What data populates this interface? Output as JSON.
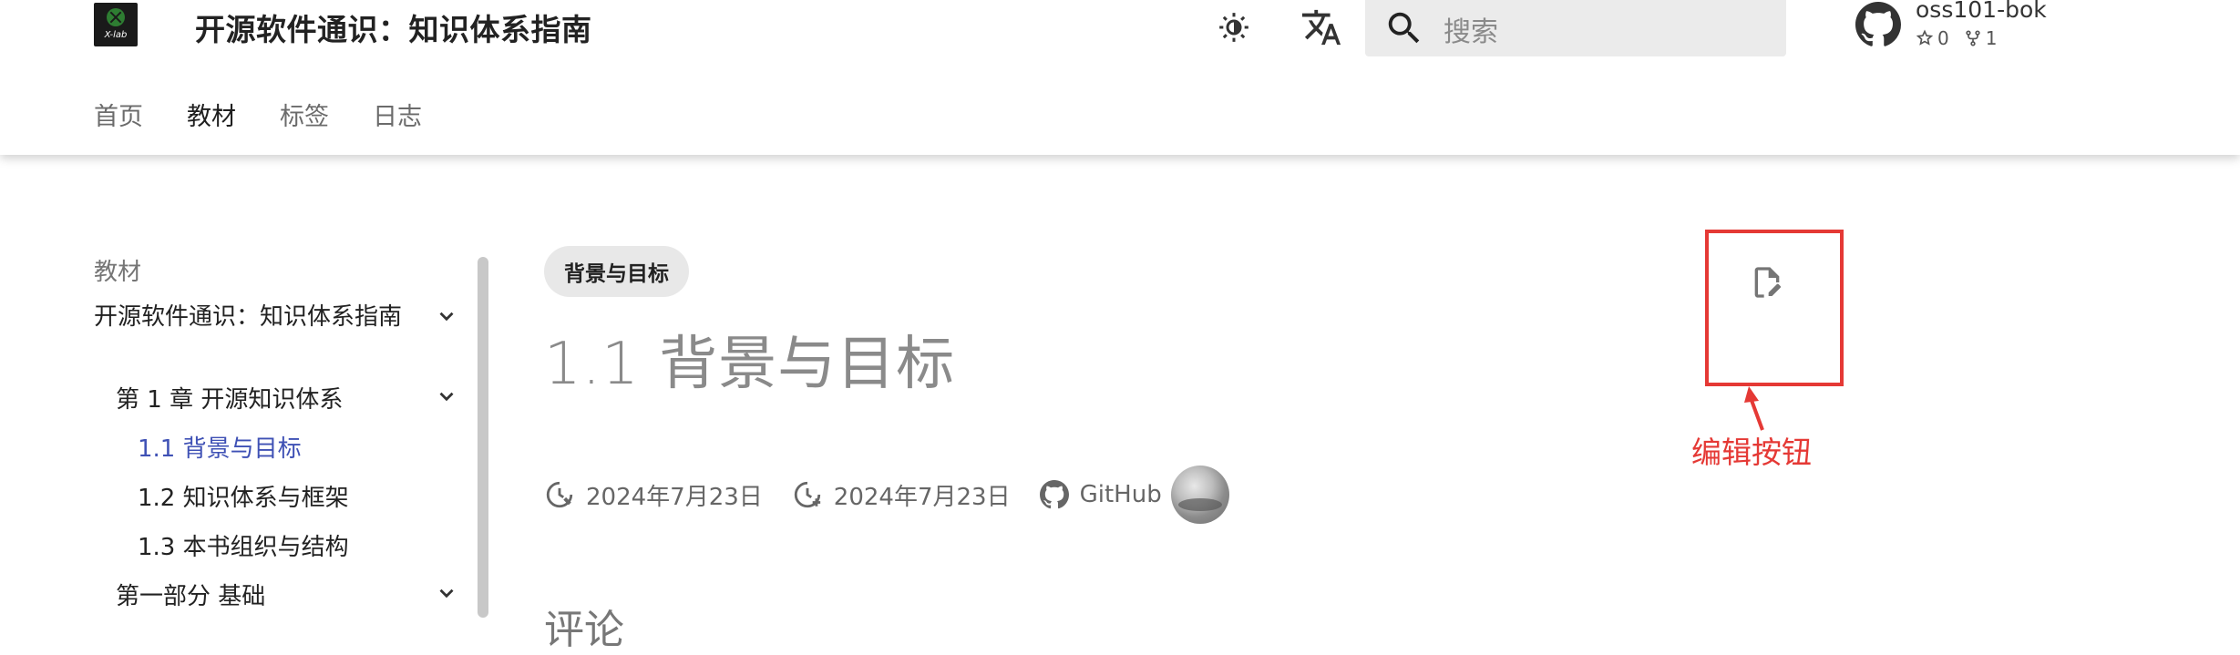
{
  "header": {
    "logo_text": "X-lab",
    "site_title": "开源软件通识：知识体系指南",
    "search_placeholder": "搜索",
    "repo_name": "oss101-bok",
    "stars": "0",
    "forks": "1",
    "icons": [
      "x-lab-logo",
      "theme-toggle-icon",
      "translate-icon",
      "search-icon",
      "github-icon",
      "star-icon",
      "fork-icon"
    ]
  },
  "tabs": [
    {
      "label": "首页",
      "active": false
    },
    {
      "label": "教材",
      "active": true
    },
    {
      "label": "标签",
      "active": false
    },
    {
      "label": "日志",
      "active": false
    }
  ],
  "sidebar": {
    "heading": "教材",
    "items": [
      {
        "label": "开源软件通识：知识体系指南",
        "level": 1,
        "expandable": true
      },
      {
        "label": "第 1 章 开源知识体系",
        "level": 2,
        "expandable": true
      },
      {
        "label": "1.1 背景与目标",
        "level": 3,
        "active": true
      },
      {
        "label": "1.2 知识体系与框架",
        "level": 3
      },
      {
        "label": "1.3 本书组织与结构",
        "level": 3
      },
      {
        "label": "第一部分 基础",
        "level": 2,
        "expandable": true
      }
    ]
  },
  "main": {
    "chip": "背景与目标",
    "title": "1.1 背景与目标",
    "created": "2024年7月23日",
    "updated": "2024年7月23日",
    "source": "GitHub",
    "comments_heading": "评论"
  },
  "annotation": {
    "label": "编辑按钮",
    "color": "#e53935"
  },
  "colors": {
    "accent": "#3f51b5",
    "highlight": "#e53935"
  }
}
